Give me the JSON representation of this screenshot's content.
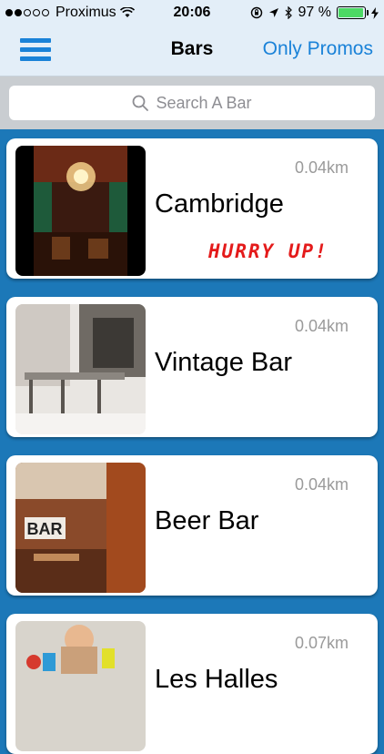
{
  "status_bar": {
    "carrier": "Proximus",
    "time": "20:06",
    "battery": "97 %",
    "battery_level": 0.97,
    "icons": [
      "signal-dots-icon",
      "wifi-icon",
      "orientation-lock-icon",
      "location-arrow-icon",
      "bluetooth-icon",
      "battery-icon",
      "charging-bolt-icon"
    ]
  },
  "navbar": {
    "title": "Bars",
    "right_button": "Only Promos",
    "left_icon": "hamburger-menu-icon"
  },
  "search": {
    "placeholder": "Search A Bar",
    "icon": "search-icon"
  },
  "bars": [
    {
      "name": "Cambridge",
      "distance": "0.04km",
      "promo": "HURRY UP!"
    },
    {
      "name": "Vintage Bar",
      "distance": "0.04km",
      "promo": ""
    },
    {
      "name": "Beer Bar",
      "distance": "0.04km",
      "promo": ""
    },
    {
      "name": "Les Halles",
      "distance": "0.07km",
      "promo": ""
    }
  ],
  "colors": {
    "accent": "#1a82d8",
    "background": "#1c78b8",
    "promo": "#e41b1b",
    "battery": "#4cd964"
  }
}
